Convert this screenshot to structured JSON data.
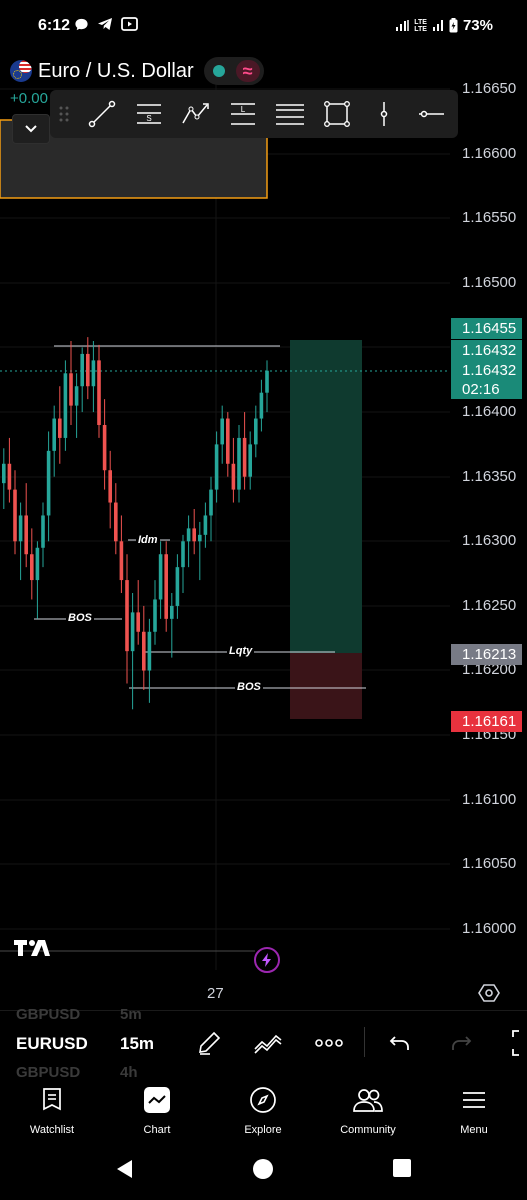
{
  "status_bar": {
    "time": "6:12",
    "battery": "73%",
    "net_top": "LTE",
    "net_bottom": "LTE"
  },
  "header": {
    "symbol": "Euro / U.S. Dollar",
    "change": "+0.00"
  },
  "price_axis": {
    "labels": [
      "1.16650",
      "1.16600",
      "1.16550",
      "1.16500",
      "1.16400",
      "1.16350",
      "1.16300",
      "1.16250",
      "1.16200",
      "1.16150",
      "1.16100",
      "1.16050",
      "1.16000"
    ],
    "tag_target": "1.16455",
    "tag_entry": "1.16432",
    "tag_current": "1.16432",
    "tag_countdown": "02:16",
    "tag_gray": "1.16213",
    "tag_stop": "1.16161"
  },
  "annotations": {
    "idm": "Idm",
    "bos_left": "BOS",
    "lqty": "Lqty",
    "bos_bottom": "BOS"
  },
  "time_axis": {
    "label": "27"
  },
  "symbol_bar": {
    "ghost_top_symbol": "GBPUSD",
    "ghost_top_interval": "5m",
    "symbol": "EURUSD",
    "interval": "15m",
    "ghost_bottom_symbol": "GBPUSD",
    "ghost_bottom_interval": "4h"
  },
  "tabs": [
    {
      "label": "Watchlist",
      "icon": "watchlist-icon"
    },
    {
      "label": "Chart",
      "icon": "chart-icon"
    },
    {
      "label": "Explore",
      "icon": "compass-icon"
    },
    {
      "label": "Community",
      "icon": "community-icon"
    },
    {
      "label": "Menu",
      "icon": "menu-icon"
    }
  ],
  "colors": {
    "up": "#26a69a",
    "down": "#ef5350",
    "target_zone": "#0f3a2f",
    "stop_zone": "#3a1418",
    "accent_pink": "#ff4b8b",
    "lightning": "#9c27b0"
  },
  "chart_data": {
    "type": "candlestick",
    "symbol": "EURUSD",
    "interval": "15m",
    "ylim": [
      1.1595,
      1.1667
    ],
    "last_price": 1.16432,
    "position": {
      "entry": 1.16432,
      "target": 1.16455,
      "stop": 1.16161
    },
    "levels": [
      {
        "label": "BOS",
        "price": 1.1624
      },
      {
        "label": "Idm",
        "price": 1.163
      },
      {
        "label": "Lqty",
        "price": 1.16213
      },
      {
        "label": "BOS",
        "price": 1.16165
      }
    ],
    "candles": [
      [
        1.16345,
        1.16372,
        1.16325,
        1.1636
      ],
      [
        1.1636,
        1.1638,
        1.1633,
        1.1634
      ],
      [
        1.1634,
        1.16355,
        1.1629,
        1.163
      ],
      [
        1.163,
        1.1633,
        1.1627,
        1.1632
      ],
      [
        1.1632,
        1.16345,
        1.1628,
        1.1629
      ],
      [
        1.1629,
        1.1631,
        1.16255,
        1.1627
      ],
      [
        1.1627,
        1.163,
        1.1624,
        1.16295
      ],
      [
        1.16295,
        1.1633,
        1.1628,
        1.1632
      ],
      [
        1.1632,
        1.16385,
        1.163,
        1.1637
      ],
      [
        1.1637,
        1.16405,
        1.1635,
        1.16395
      ],
      [
        1.16395,
        1.1642,
        1.1636,
        1.1638
      ],
      [
        1.1638,
        1.1644,
        1.1637,
        1.1643
      ],
      [
        1.1643,
        1.16455,
        1.1639,
        1.16405
      ],
      [
        1.16405,
        1.1643,
        1.1638,
        1.1642
      ],
      [
        1.1642,
        1.1645,
        1.164,
        1.16445
      ],
      [
        1.16445,
        1.16458,
        1.1641,
        1.1642
      ],
      [
        1.1642,
        1.16455,
        1.164,
        1.1644
      ],
      [
        1.1644,
        1.16452,
        1.1638,
        1.1639
      ],
      [
        1.1639,
        1.1641,
        1.1634,
        1.16355
      ],
      [
        1.16355,
        1.1637,
        1.1631,
        1.1633
      ],
      [
        1.1633,
        1.16345,
        1.1629,
        1.163
      ],
      [
        1.163,
        1.1632,
        1.1626,
        1.1627
      ],
      [
        1.1627,
        1.1629,
        1.1619,
        1.16215
      ],
      [
        1.16215,
        1.1626,
        1.1617,
        1.16245
      ],
      [
        1.16245,
        1.1627,
        1.1622,
        1.1623
      ],
      [
        1.1623,
        1.1625,
        1.16185,
        1.162
      ],
      [
        1.162,
        1.1624,
        1.16175,
        1.1623
      ],
      [
        1.1623,
        1.1627,
        1.1622,
        1.16255
      ],
      [
        1.16255,
        1.163,
        1.1624,
        1.1629
      ],
      [
        1.1629,
        1.163,
        1.1623,
        1.1624
      ],
      [
        1.1624,
        1.1626,
        1.1621,
        1.1625
      ],
      [
        1.1625,
        1.1629,
        1.1624,
        1.1628
      ],
      [
        1.1628,
        1.16305,
        1.1626,
        1.163
      ],
      [
        1.163,
        1.1632,
        1.1628,
        1.1631
      ],
      [
        1.1631,
        1.16325,
        1.1629,
        1.163
      ],
      [
        1.163,
        1.16315,
        1.1627,
        1.16305
      ],
      [
        1.16305,
        1.1633,
        1.16295,
        1.1632
      ],
      [
        1.1632,
        1.1635,
        1.163,
        1.1634
      ],
      [
        1.1634,
        1.16385,
        1.1633,
        1.16375
      ],
      [
        1.16375,
        1.16405,
        1.1636,
        1.16395
      ],
      [
        1.16395,
        1.164,
        1.1635,
        1.1636
      ],
      [
        1.1636,
        1.1638,
        1.1633,
        1.1634
      ],
      [
        1.1634,
        1.1639,
        1.1633,
        1.1638
      ],
      [
        1.1638,
        1.164,
        1.1634,
        1.1635
      ],
      [
        1.1635,
        1.16385,
        1.1634,
        1.16375
      ],
      [
        1.16375,
        1.16405,
        1.16365,
        1.16395
      ],
      [
        1.16395,
        1.16425,
        1.16385,
        1.16415
      ],
      [
        1.16415,
        1.1644,
        1.164,
        1.16432
      ]
    ]
  }
}
